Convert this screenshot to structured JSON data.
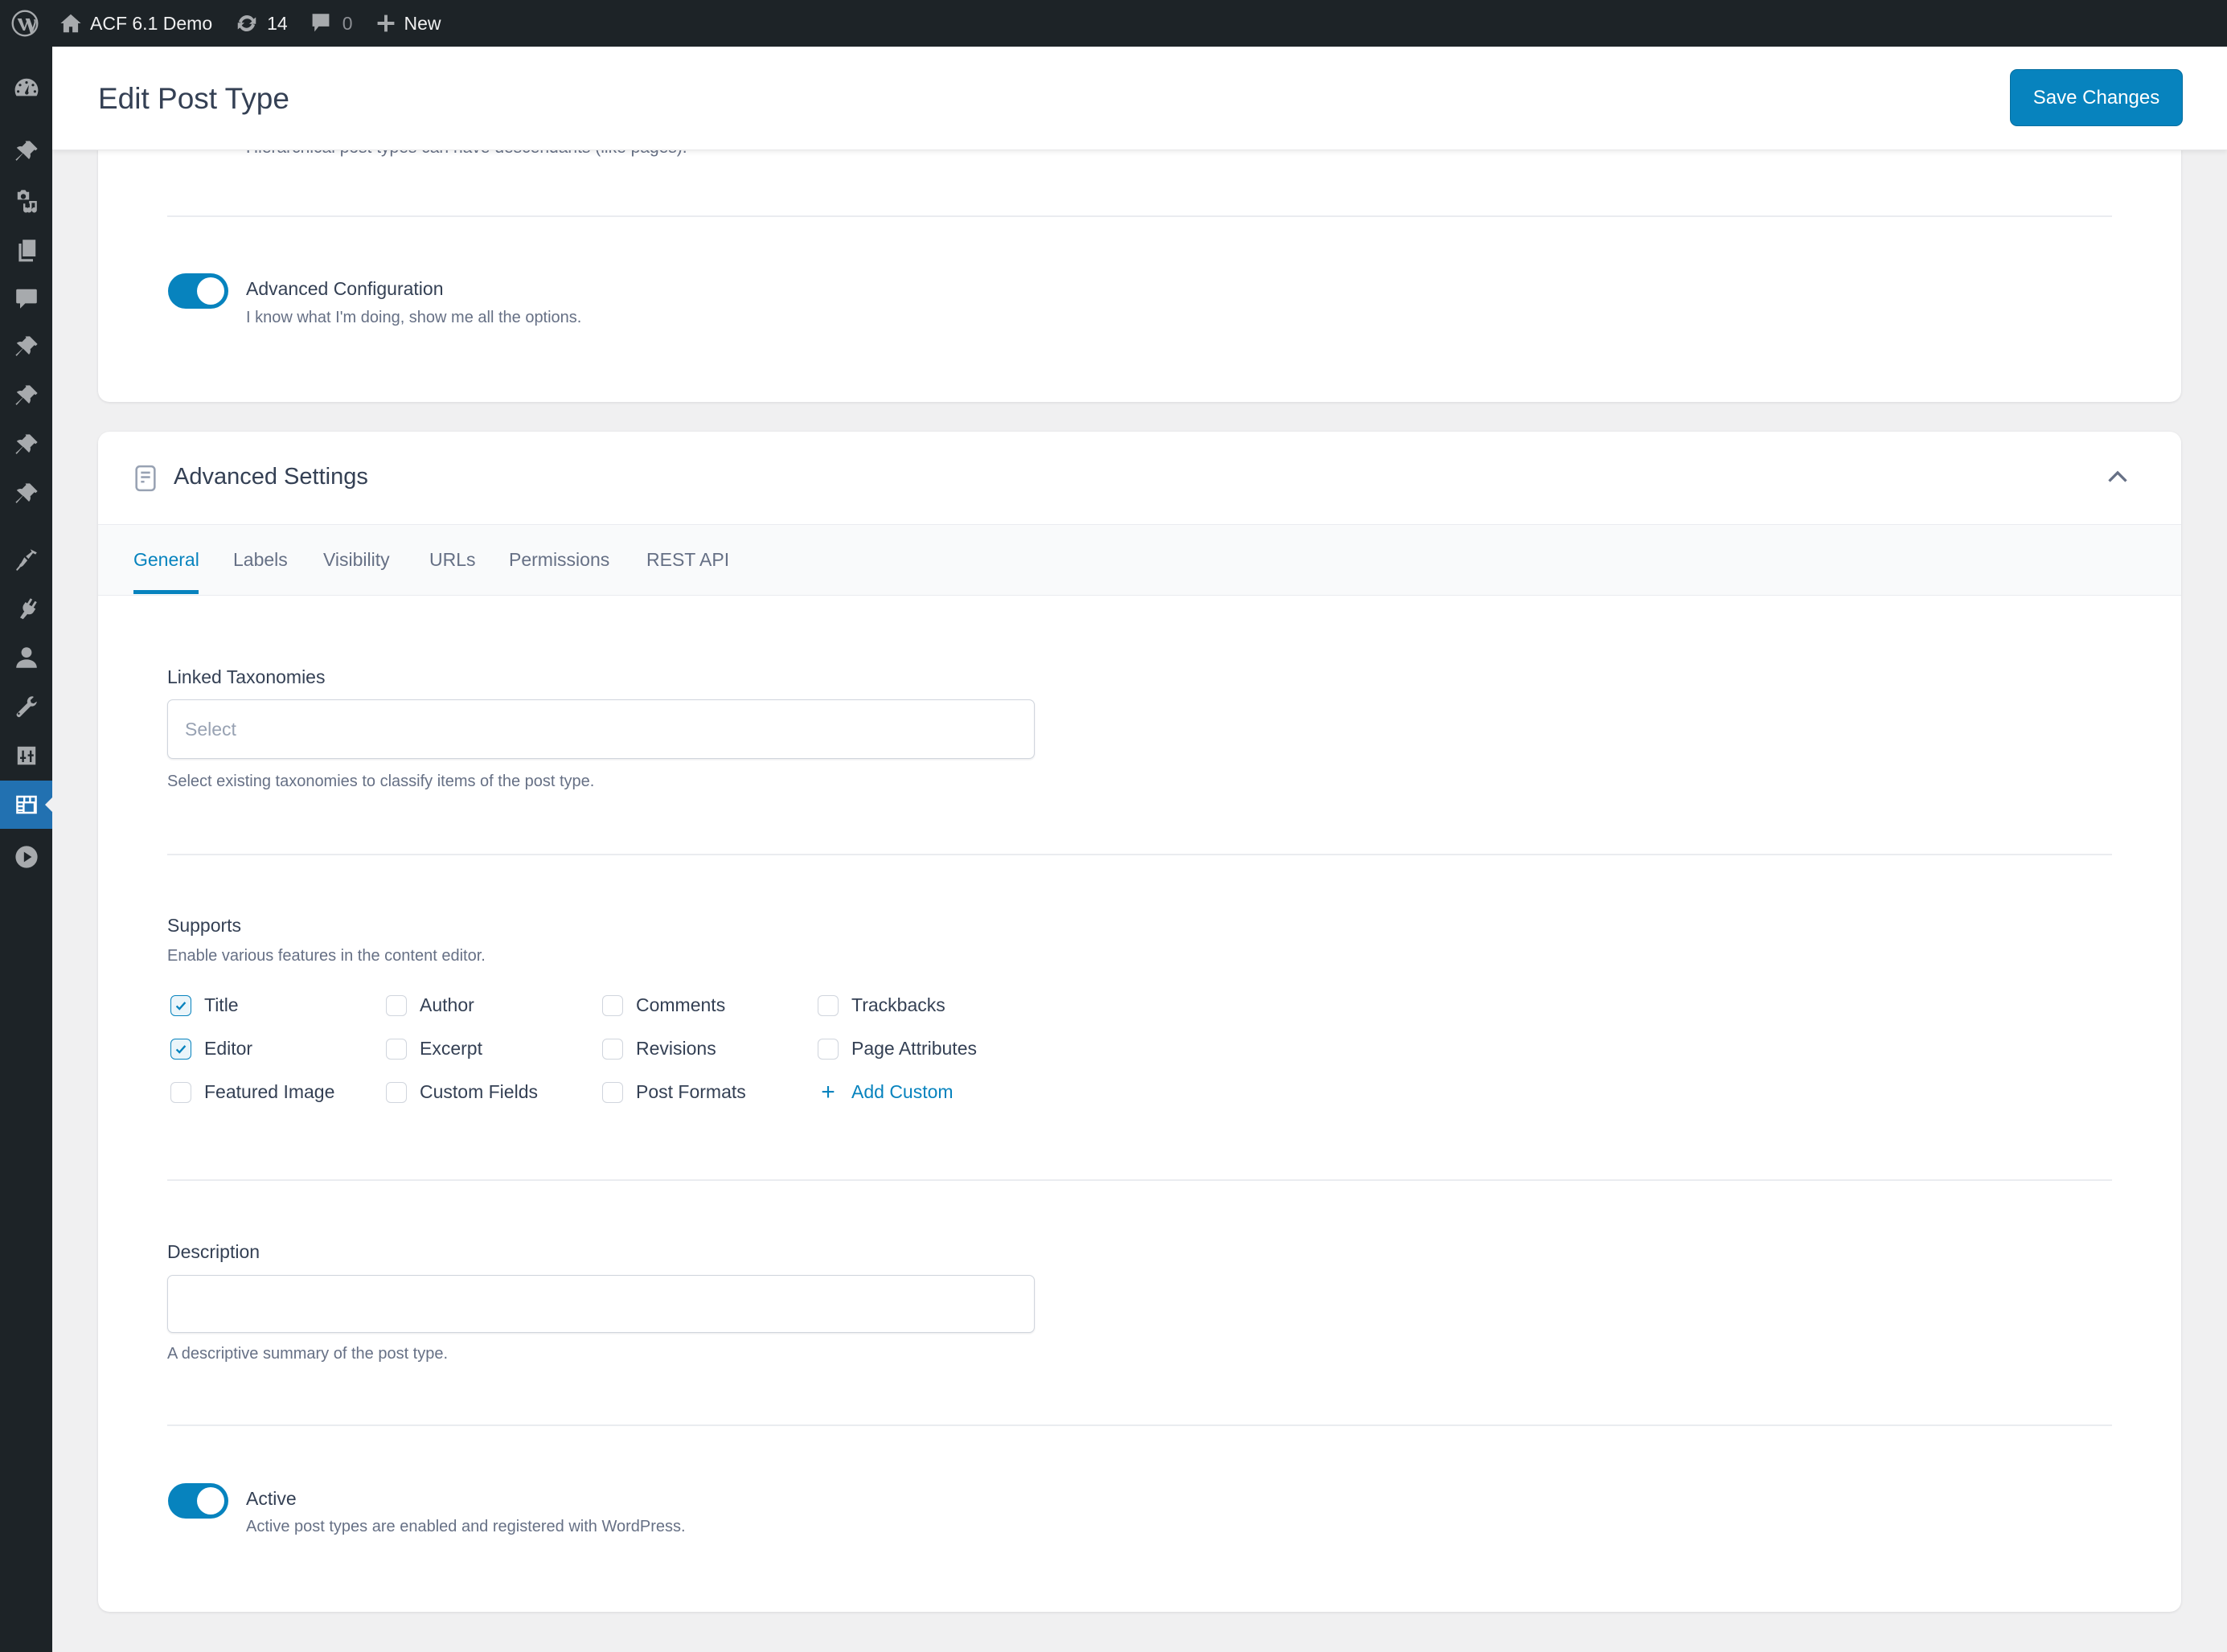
{
  "admin_bar": {
    "site_name": "ACF 6.1 Demo",
    "updates_count": "14",
    "comments_count": "0",
    "new_label": "New"
  },
  "sidebar": {
    "items": [
      {
        "icon": "dashboard-icon"
      },
      {
        "icon": "pin-icon"
      },
      {
        "icon": "media-icon"
      },
      {
        "icon": "pages-icon"
      },
      {
        "icon": "comments-icon"
      },
      {
        "icon": "pin-icon"
      },
      {
        "icon": "pin-icon"
      },
      {
        "icon": "pin-icon"
      },
      {
        "icon": "pin-icon"
      },
      {
        "icon": "appearance-icon"
      },
      {
        "icon": "plugins-icon"
      },
      {
        "icon": "users-icon"
      },
      {
        "icon": "tools-icon"
      },
      {
        "icon": "settings-icon"
      },
      {
        "icon": "acf-icon",
        "active": true
      },
      {
        "icon": "play-icon"
      }
    ]
  },
  "header": {
    "title": "Edit Post Type",
    "save_label": "Save Changes"
  },
  "basic_card": {
    "truncated_help": "Hierarchical post types can have descendants (like pages).",
    "advanced_config": {
      "title": "Advanced Configuration",
      "description": "I know what I'm doing, show me all the options.",
      "enabled": true
    }
  },
  "advanced_settings": {
    "title": "Advanced Settings",
    "tabs": [
      {
        "label": "General",
        "active": true
      },
      {
        "label": "Labels"
      },
      {
        "label": "Visibility"
      },
      {
        "label": "URLs"
      },
      {
        "label": "Permissions"
      },
      {
        "label": "REST API"
      }
    ],
    "linked_taxonomies": {
      "label": "Linked Taxonomies",
      "placeholder": "Select",
      "help": "Select existing taxonomies to classify items of the post type."
    },
    "supports": {
      "label": "Supports",
      "help": "Enable various features in the content editor.",
      "options": [
        {
          "label": "Title",
          "checked": true
        },
        {
          "label": "Editor",
          "checked": true
        },
        {
          "label": "Featured Image",
          "checked": false
        },
        {
          "label": "Author",
          "checked": false
        },
        {
          "label": "Excerpt",
          "checked": false
        },
        {
          "label": "Custom Fields",
          "checked": false
        },
        {
          "label": "Comments",
          "checked": false
        },
        {
          "label": "Revisions",
          "checked": false
        },
        {
          "label": "Post Formats",
          "checked": false
        },
        {
          "label": "Trackbacks",
          "checked": false
        },
        {
          "label": "Page Attributes",
          "checked": false
        }
      ],
      "add_custom_label": "Add Custom"
    },
    "description": {
      "label": "Description",
      "value": "",
      "help": "A descriptive summary of the post type."
    },
    "active": {
      "title": "Active",
      "description": "Active post types are enabled and registered with WordPress.",
      "enabled": true
    }
  },
  "colors": {
    "accent": "#0783be",
    "admin_bar": "#1d2327",
    "sidebar_active": "#2271b1"
  }
}
